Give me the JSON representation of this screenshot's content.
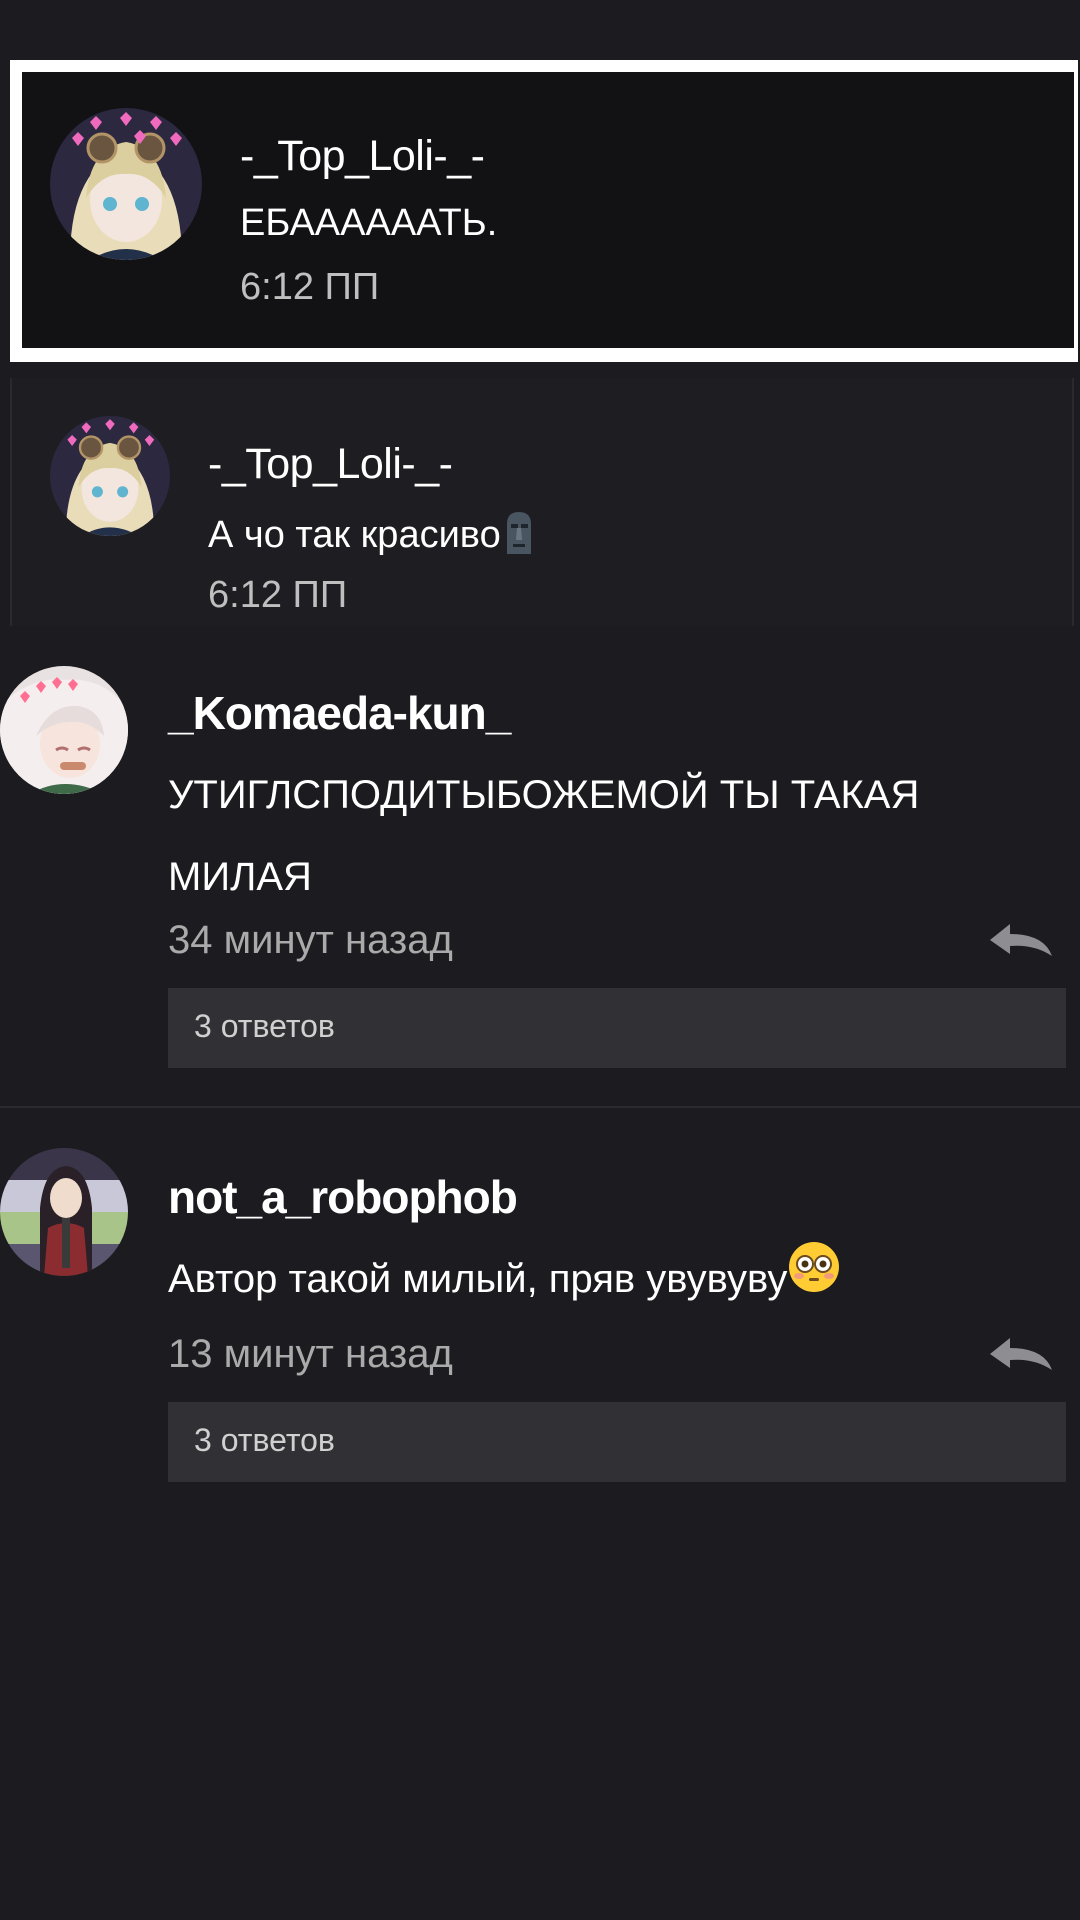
{
  "notifications": [
    {
      "username": "-_Top_Loli-_-",
      "message": "ЕБААААААТЬ.",
      "time": "6:12 ПП",
      "avatar_icon": "anime-avatar-icon"
    },
    {
      "username": "-_Top_Loli-_-",
      "message": "А чо так красиво",
      "time": "6:12 ПП",
      "avatar_icon": "anime-avatar-icon",
      "emoji": "moai-emoji-icon"
    }
  ],
  "comments": [
    {
      "username": "_Komaeda-kun_",
      "text": "УТИГЛСПОДИТЫБОЖЕМОЙ ТЫ ТАКАЯ МИЛАЯ",
      "time": "34 минут назад",
      "replies": "3 ответов",
      "avatar_icon": "anime-avatar-icon"
    },
    {
      "username": "not_a_robophob",
      "text": "Автор такой милый, пряв увувуву",
      "time": "13 минут назад",
      "replies": "3 ответов",
      "avatar_icon": "anime-avatar-icon",
      "emoji": "flushed-face-emoji-icon"
    }
  ],
  "colors": {
    "background": "#1c1b1f",
    "highlight_border": "#ffffff",
    "reply_box": "#313034",
    "secondary_text": "#aaaaaa"
  }
}
